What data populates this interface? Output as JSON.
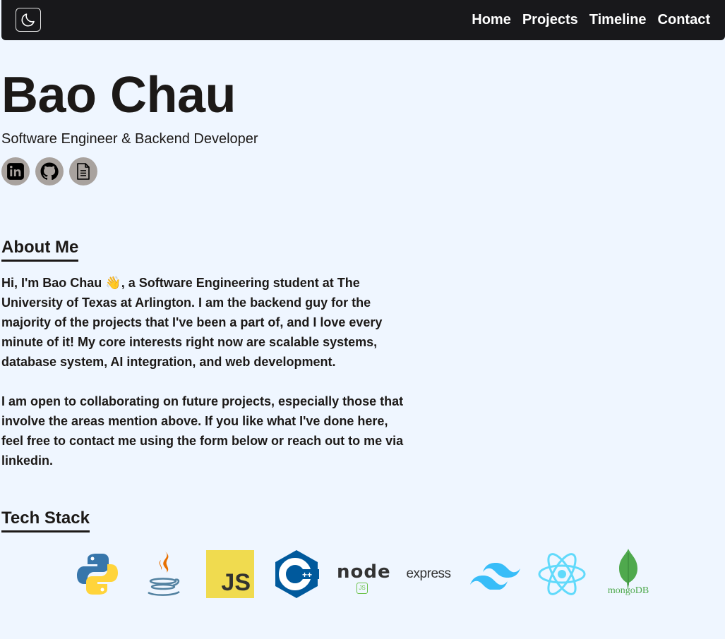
{
  "nav": {
    "theme_toggle_icon": "moon-icon",
    "links": [
      "Home",
      "Projects",
      "Timeline",
      "Contact"
    ]
  },
  "hero": {
    "name": "Bao Chau",
    "subtitle": "Software Engineer & Backend Developer",
    "socials": [
      "linkedin-icon",
      "github-icon",
      "resume-document-icon"
    ]
  },
  "about": {
    "heading": "About Me",
    "paragraph1": "Hi, I'm Bao Chau 👋, a Software Engineering student at The University of Texas at Arlington. I am the backend guy for the majority of the projects that I've been a part of, and I love every minute of it! My core interests right now are scalable systems, database system, AI integration, and web development.",
    "paragraph2": "I am open to collaborating on future projects, especially those that involve the areas mention above. If you like what I've done here, feel free to contact me using the form below or reach out to me via linkedin."
  },
  "tech": {
    "heading": "Tech Stack",
    "logos": [
      "python-logo",
      "java-logo",
      "javascript-logo",
      "cplusplus-logo",
      "nodejs-logo",
      "express-logo",
      "tailwind-logo",
      "react-logo",
      "mongodb-logo"
    ],
    "js_text": "JS",
    "cpp_text": "C",
    "node_text": "node",
    "node_sub": "JS",
    "express_text": "express",
    "mongo_text": "mongoDB"
  },
  "colors": {
    "background": "#eff6ff",
    "navbar": "#18181b",
    "text": "#1c1917",
    "social_bg": "#a8a29e"
  }
}
